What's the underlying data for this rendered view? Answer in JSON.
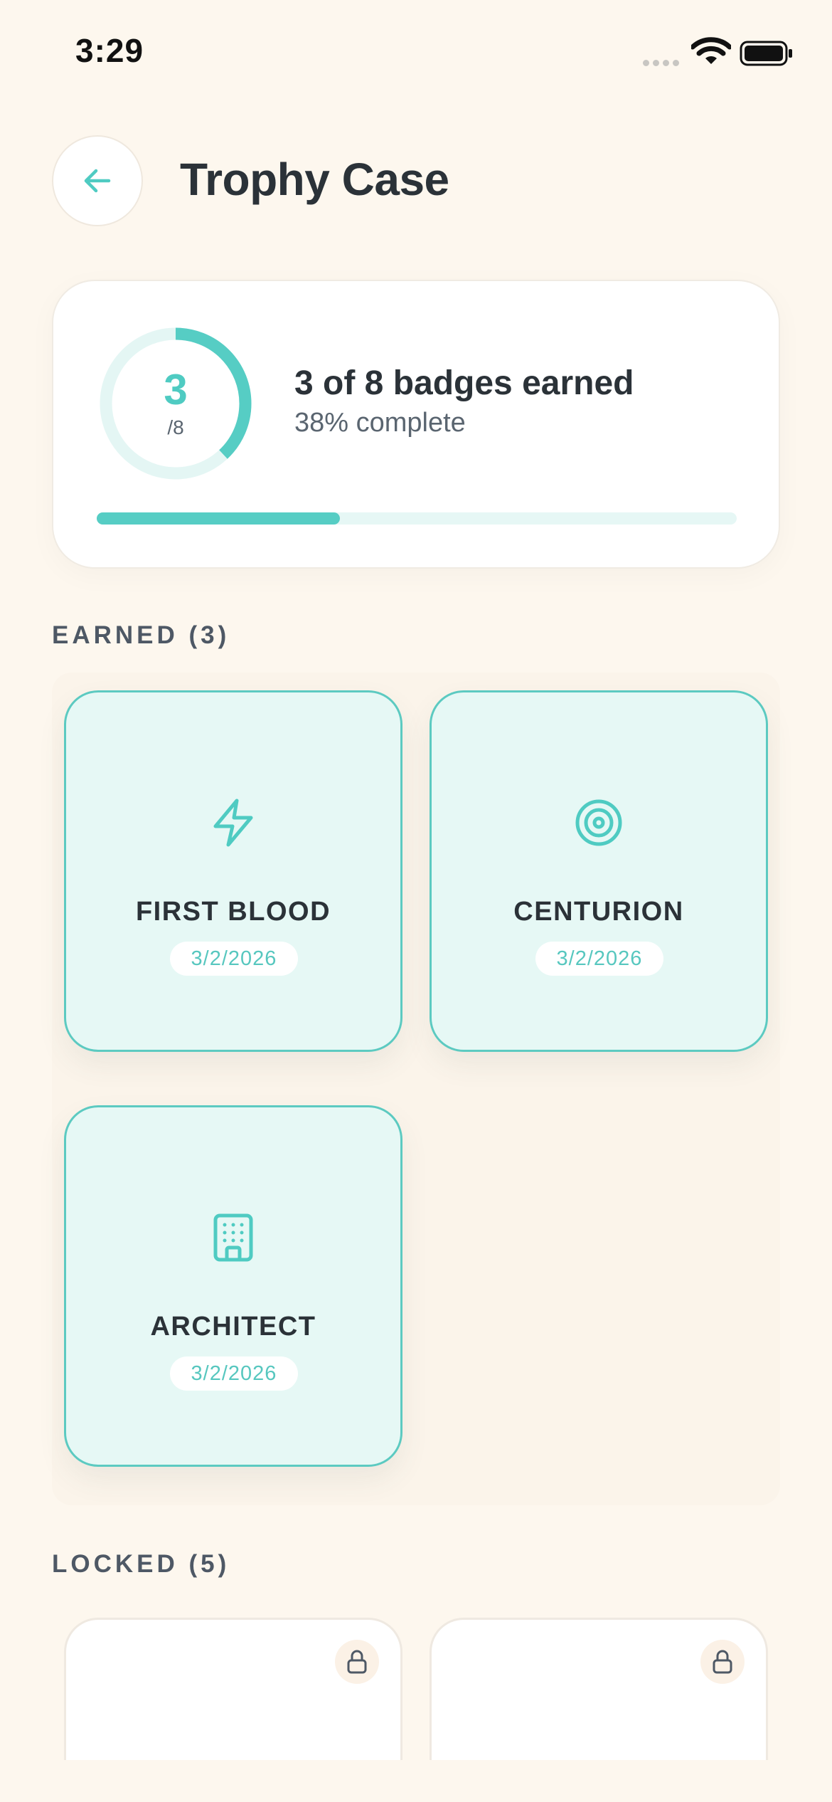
{
  "status": {
    "time": "3:29"
  },
  "header": {
    "title": "Trophy Case"
  },
  "summary": {
    "earned": "3",
    "total_label": "/8",
    "heading": "3 of 8 badges earned",
    "subtext": "38% complete",
    "progress_fraction": 0.38
  },
  "sections": {
    "earned_label": "EARNED (3)",
    "locked_label": "LOCKED (5)"
  },
  "earned_badges": [
    {
      "name": "FIRST BLOOD",
      "date": "3/2/2026",
      "icon": "lightning-icon"
    },
    {
      "name": "CENTURION",
      "date": "3/2/2026",
      "icon": "target-icon"
    },
    {
      "name": "ARCHITECT",
      "date": "3/2/2026",
      "icon": "building-icon"
    }
  ],
  "locked_badges": [
    {
      "icon": "lock-icon"
    },
    {
      "icon": "lock-icon"
    }
  ],
  "colors": {
    "accent": "#56cdc4",
    "background": "#fdf7ee",
    "text": "#2b3238"
  }
}
